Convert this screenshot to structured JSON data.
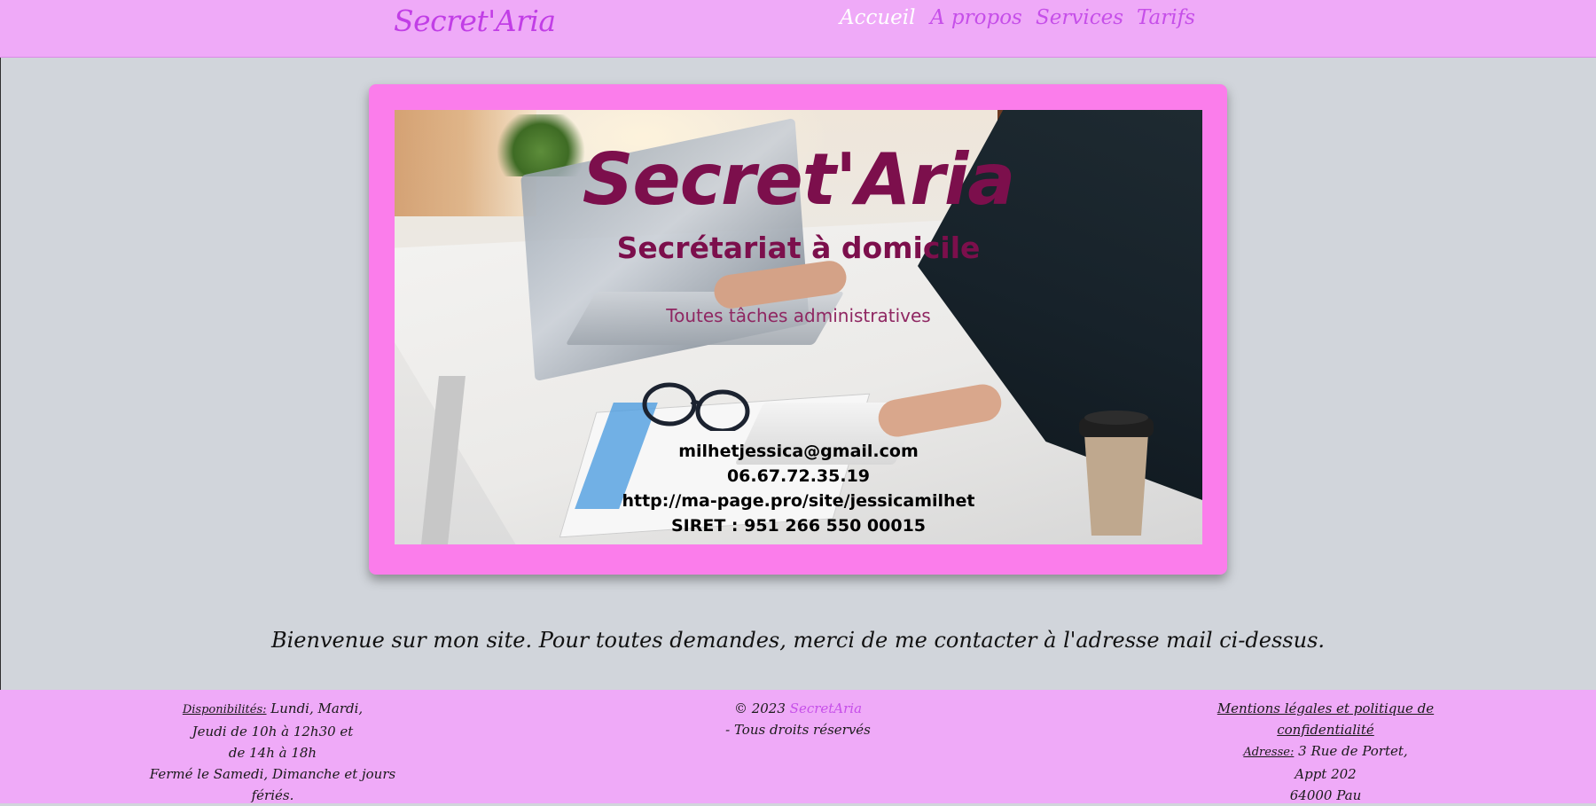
{
  "header": {
    "brand": "Secret'Aria",
    "nav": [
      {
        "label": "Accueil",
        "active": true
      },
      {
        "label": "A propos",
        "active": false
      },
      {
        "label": "Services",
        "active": false
      },
      {
        "label": "Tarifs",
        "active": false
      }
    ]
  },
  "hero": {
    "title": "Secret'Aria",
    "subtitle": "Secrétariat à domicile",
    "tagline": "Toutes tâches administratives",
    "email": "milhetjessica@gmail.com",
    "phone": "06.67.72.35.19",
    "website": "http://ma-page.pro/site/jessicamilhet",
    "siret": "SIRET : 951 266 550 00015"
  },
  "welcome": "Bienvenue sur mon site. Pour toutes demandes, merci de me contacter à l'adresse mail ci-dessus.",
  "footer": {
    "availability_label": "Disponibilités:",
    "availability_line1": " Lundi, Mardi,",
    "availability_line2": "Jeudi de 10h à 12h30 et",
    "availability_line3": "de 14h à 18h",
    "availability_line4": "Fermé le Samedi, Dimanche et jours fériés.",
    "copyright_prefix": "© 2023 ",
    "copyright_brand": "SecretAria",
    "copyright_suffix": "- Tous droits réservés",
    "legal_link": "Mentions légales et politique de confidentialité",
    "address_label": "Adresse:",
    "address_line1": " 3 Rue de Portet,",
    "address_line2": "Appt 202",
    "address_line3": "64000 Pau"
  },
  "colors": {
    "header_bg": "#efaaf8",
    "accent": "#c64fe9",
    "hero_frame": "#fb7deb",
    "page_bg": "#d1d5db",
    "hero_text": "#7c0f4c"
  }
}
